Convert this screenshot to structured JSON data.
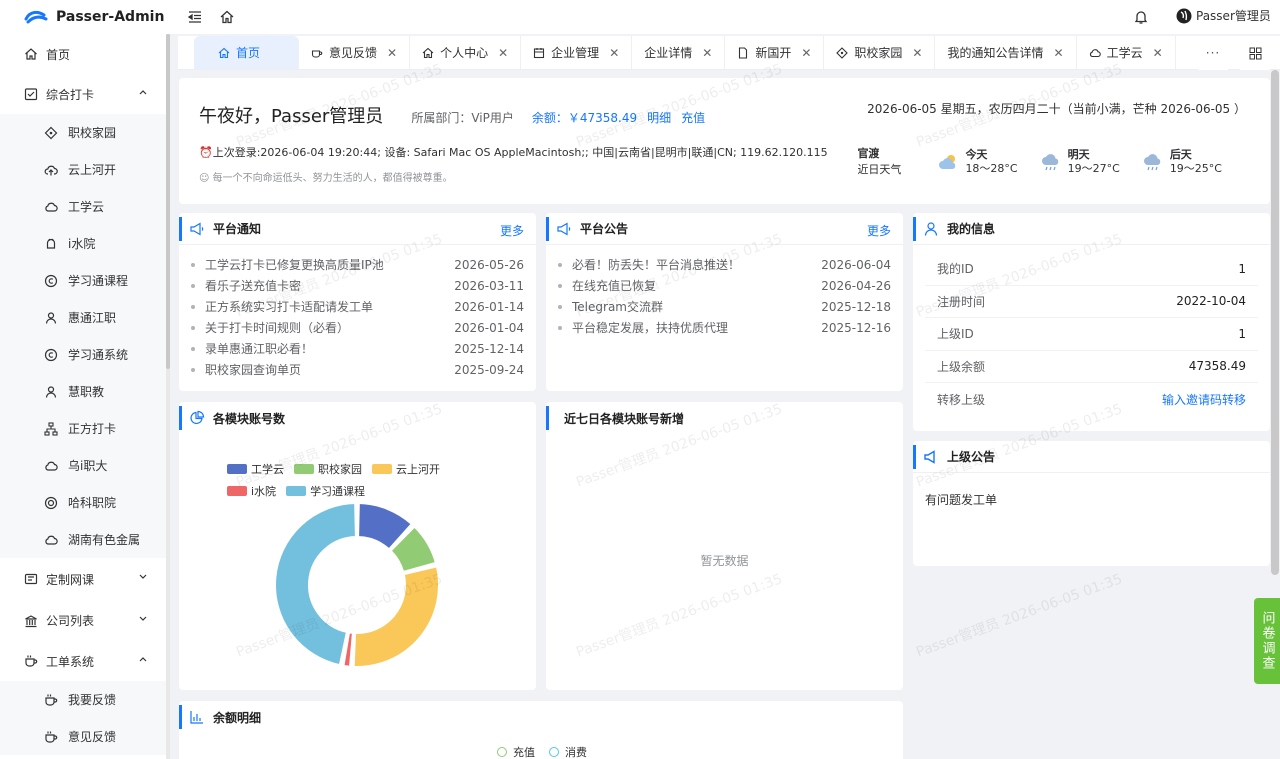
{
  "app": {
    "title": "Passer-Admin"
  },
  "header": {
    "user_name": "Passer管理员"
  },
  "sidebar": {
    "items": [
      {
        "label": "首页",
        "icon": "home-icon"
      },
      {
        "label": "综合打卡",
        "icon": "checkin-icon",
        "expanded": true
      },
      {
        "label": "职校家园",
        "icon": "diamond-icon"
      },
      {
        "label": "云上河开",
        "icon": "cloud-upload-icon"
      },
      {
        "label": "工学云",
        "icon": "cloud-icon"
      },
      {
        "label": "i水院",
        "icon": "android-icon"
      },
      {
        "label": "学习通课程",
        "icon": "copyright-icon"
      },
      {
        "label": "惠通江职",
        "icon": "user-icon"
      },
      {
        "label": "学习通系统",
        "icon": "copyright-icon"
      },
      {
        "label": "慧职教",
        "icon": "user-icon"
      },
      {
        "label": "正方打卡",
        "icon": "sitemap-icon"
      },
      {
        "label": "乌i职大",
        "icon": "cloud-icon"
      },
      {
        "label": "哈科职院",
        "icon": "target-icon"
      },
      {
        "label": "湖南有色金属",
        "icon": "cloud-icon"
      },
      {
        "label": "定制网课",
        "icon": "tablet-icon",
        "expanded": false
      },
      {
        "label": "公司列表",
        "icon": "bank-icon",
        "expanded": false
      },
      {
        "label": "工单系统",
        "icon": "coffee-icon",
        "expanded": true
      },
      {
        "label": "我要反馈",
        "icon": "coffee-icon"
      },
      {
        "label": "意见反馈",
        "icon": "coffee-icon"
      }
    ]
  },
  "tabs": [
    {
      "label": "首页",
      "icon": "home-icon"
    },
    {
      "label": "意见反馈",
      "icon": "coffee-icon"
    },
    {
      "label": "个人中心",
      "icon": "home-icon"
    },
    {
      "label": "企业管理",
      "icon": "calendar-icon"
    },
    {
      "label": "企业详情",
      "icon": ""
    },
    {
      "label": "新国开",
      "icon": "file-icon"
    },
    {
      "label": "职校家园",
      "icon": "diamond-icon"
    },
    {
      "label": "我的通知公告详情",
      "icon": ""
    },
    {
      "label": "工学云",
      "icon": "cloud-icon"
    }
  ],
  "tab_more": "···",
  "welcome": {
    "greeting": "午夜好，Passer管理员",
    "dept": "所属部门：ViP用户",
    "balance": "余额：￥47358.49",
    "link_detail": "明细",
    "link_recharge": "充值",
    "last_login": "上次登录:2026-06-04 19:20:44; 设备: Safari Mac OS AppleMacintosh;; 中国|云南省|昆明市|联通|CN; 119.62.120.115",
    "motto": "每一个不向命运低头、努力生活的人，都值得被尊重。",
    "date": "2026-06-05 星期五，农历四月二十（当前小满，芒种 2026-06-05 ）",
    "weather": {
      "city": "官渡",
      "sub": "近日天气",
      "days": [
        {
          "day": "今天",
          "temp": "18～28°C",
          "icon": "sun-cloud-icon"
        },
        {
          "day": "明天",
          "temp": "19～27°C",
          "icon": "rain-cloud-icon"
        },
        {
          "day": "后天",
          "temp": "19～25°C",
          "icon": "rain-cloud-icon"
        }
      ]
    }
  },
  "platform_notice": {
    "title": "平台通知",
    "more": "更多",
    "items": [
      {
        "text": "工学云打卡已修复更换高质量IP池",
        "date": "2026-05-26"
      },
      {
        "text": "看乐子送充值卡密",
        "date": "2026-03-11"
      },
      {
        "text": "正方系统实习打卡适配请发工单",
        "date": "2026-01-14"
      },
      {
        "text": "关于打卡时间规则（必看）",
        "date": "2026-01-04"
      },
      {
        "text": "录单惠通江职必看！",
        "date": "2025-12-14"
      },
      {
        "text": "职校家园查询单页",
        "date": "2025-09-24"
      }
    ]
  },
  "platform_announce": {
    "title": "平台公告",
    "more": "更多",
    "items": [
      {
        "text": "必看！防丢失！平台消息推送！",
        "date": "2026-06-04"
      },
      {
        "text": "在线充值已恢复",
        "date": "2026-04-26"
      },
      {
        "text": "Telegram交流群",
        "date": "2025-12-18"
      },
      {
        "text": "平台稳定发展，扶持优质代理",
        "date": "2025-12-16"
      }
    ]
  },
  "my_info": {
    "title": "我的信息",
    "rows": [
      {
        "label": "我的ID",
        "value": "1"
      },
      {
        "label": "注册时间",
        "value": "2022-10-04"
      },
      {
        "label": "上级ID",
        "value": "1"
      },
      {
        "label": "上级余额",
        "value": "47358.49"
      },
      {
        "label": "转移上级",
        "value": "输入邀请码转移"
      }
    ]
  },
  "superior_notice": {
    "title": "上级公告",
    "content": "有问题发工单"
  },
  "module_accounts": {
    "title": "各模块账号数"
  },
  "chart_data": {
    "type": "pie",
    "categories": [
      "工学云",
      "职校家园",
      "云上河开",
      "i水院",
      "学习通课程"
    ],
    "values": [
      12,
      9,
      30,
      2,
      47
    ],
    "colors": [
      "#5470c6",
      "#91cc75",
      "#fac858",
      "#ee6666",
      "#73c0de"
    ]
  },
  "weekly_new": {
    "title": "近七日各模块账号新增",
    "empty": "暂无数据"
  },
  "balance_detail": {
    "title": "余额明细",
    "legend": [
      "充值",
      "消费"
    ]
  },
  "survey": "问卷调查",
  "watermark": "Passer管理员 2026-06-05 01:35"
}
